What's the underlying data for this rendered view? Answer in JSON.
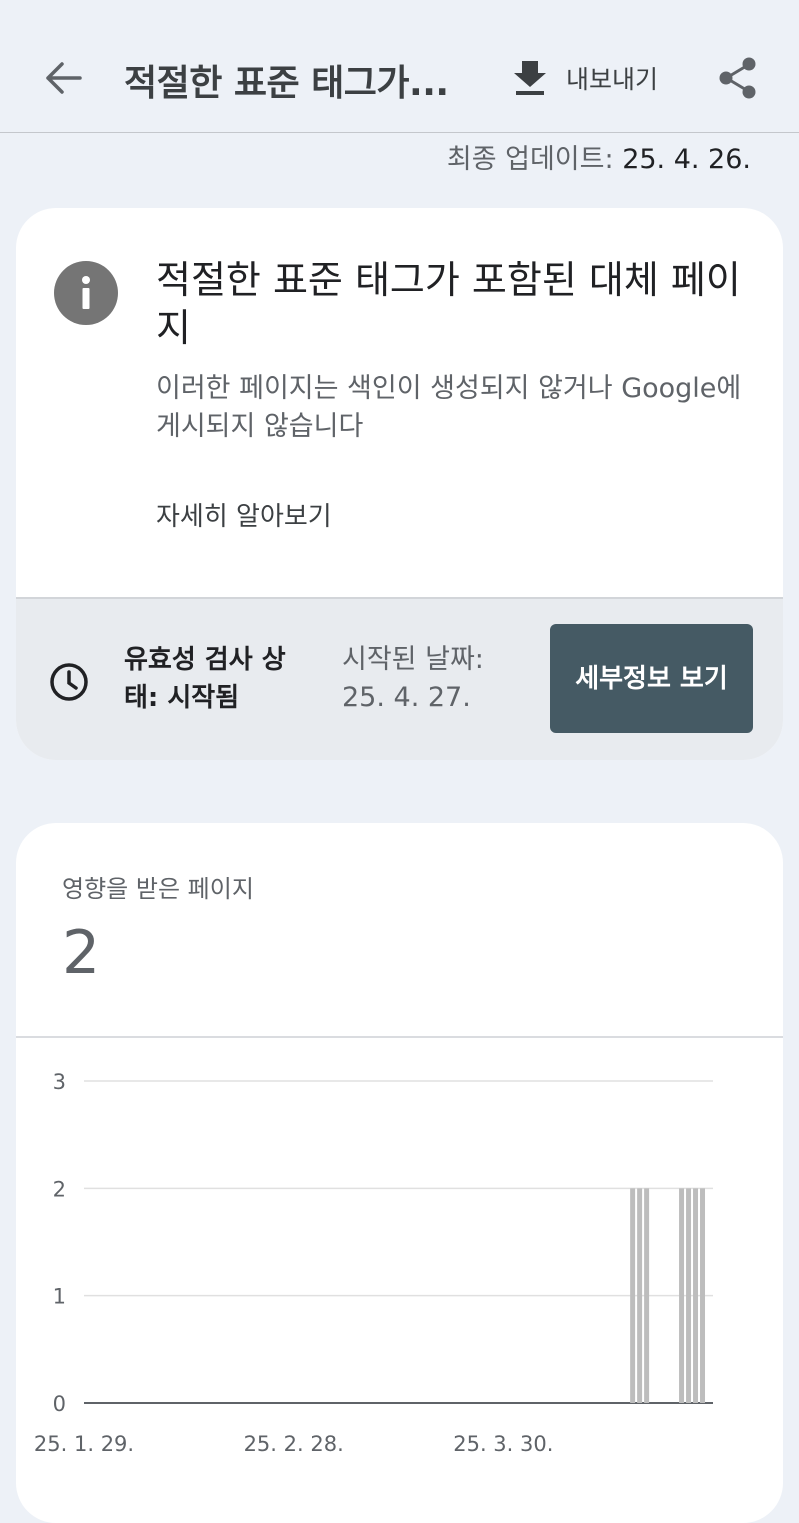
{
  "header": {
    "title": "적절한 표준 태그가...",
    "export_label": "내보내기"
  },
  "last_updated": {
    "label": "최종 업데이트:",
    "date": "25. 4. 26."
  },
  "issue_card": {
    "title": "적절한 표준 태그가 포함된 대체 페이지",
    "description": "이러한 페이지는 색인이 생성되지 않거나 Google에 게시되지 않습니다",
    "learn_more": "자세히 알아보기",
    "validation": {
      "status": "유효성 검사 상태: 시작됨",
      "started_label": "시작된 날짜:",
      "started_date": "25. 4. 27.",
      "details_button": "세부정보 보기"
    }
  },
  "metric": {
    "label": "영향을 받은 페이지",
    "value": "2"
  },
  "chart_data": {
    "type": "bar",
    "title": "",
    "xlabel": "",
    "ylabel": "",
    "ylim": [
      0,
      3
    ],
    "y_ticks": [
      "0",
      "1",
      "2",
      "3"
    ],
    "x_tick_labels": [
      "25. 1. 29.",
      "25. 2. 28.",
      "25. 3. 30."
    ],
    "x_range": [
      "2025-01-29",
      "2025-04-29"
    ],
    "grid": true,
    "bar_color": "#bdbdbd",
    "bars": [
      {
        "date": "2025-04-17",
        "value": 2
      },
      {
        "date": "2025-04-18",
        "value": 2
      },
      {
        "date": "2025-04-19",
        "value": 2
      },
      {
        "date": "2025-04-24",
        "value": 2
      },
      {
        "date": "2025-04-25",
        "value": 2
      },
      {
        "date": "2025-04-26",
        "value": 2
      },
      {
        "date": "2025-04-27",
        "value": 2
      }
    ]
  },
  "colors": {
    "background": "#edf1f7",
    "card": "#ffffff",
    "button": "#455a64",
    "info_icon": "#757575"
  }
}
